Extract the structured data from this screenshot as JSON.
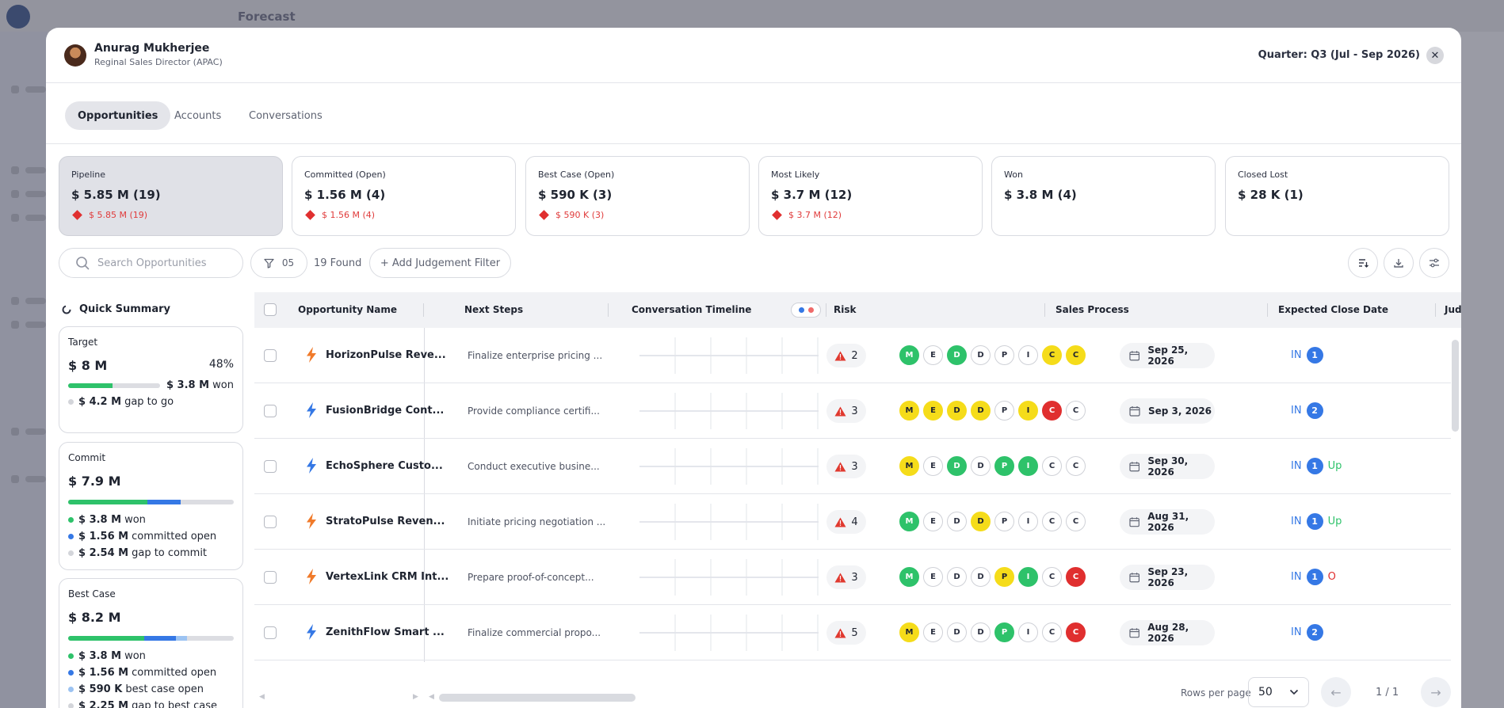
{
  "header": {
    "user_name": "Anurag Mukherjee",
    "user_role": "Reginal Sales Director (APAC)",
    "quarter": "Quarter: Q3 (Jul - Sep 2026)",
    "close_icon": "close-icon"
  },
  "tabs": [
    {
      "label": "Opportunities",
      "active": true
    },
    {
      "label": "Accounts",
      "active": false
    },
    {
      "label": "Conversations",
      "active": false
    }
  ],
  "cards": [
    {
      "label": "Pipeline",
      "value": "$ 5.85 M (19)",
      "sub": "$ 5.85 M (19)"
    },
    {
      "label": "Committed (Open)",
      "value": "$ 1.56 M (4)",
      "sub": "$ 1.56 M (4)"
    },
    {
      "label": "Best Case (Open)",
      "value": "$ 590 K (3)",
      "sub": "$ 590 K (3)"
    },
    {
      "label": "Most Likely",
      "value": "$ 3.7 M (12)",
      "sub": "$ 3.7 M (12)"
    },
    {
      "label": "Won",
      "value": "$ 3.8 M (4)",
      "sub": ""
    },
    {
      "label": "Closed Lost",
      "value": "$ 28 K (1)",
      "sub": ""
    }
  ],
  "filters": {
    "search_placeholder": "Search Opportunities",
    "filter_count": "05",
    "found": "19 Found",
    "add_judgement": "+ Add Judgement Filter"
  },
  "summary": {
    "title": "Quick Summary",
    "target": {
      "label": "Target",
      "value": "$ 8 M",
      "pct": "48%",
      "won_amount": "$ 3.8 M",
      "won_text": "won",
      "gap_amount": "$ 4.2 M",
      "gap_text": "gap to go",
      "fill": 0.48
    },
    "commit": {
      "label": "Commit",
      "value": "$ 7.9 M",
      "won_amount": "$ 3.8 M",
      "won_text": "won",
      "committed_amount": "$ 1.56 M",
      "committed_text": "committed open",
      "gap_amount": "$ 2.54 M",
      "gap_text": "gap to commit",
      "won_fill": 0.48,
      "committed_fill": 0.2
    },
    "best_case": {
      "label": "Best Case",
      "value": "$ 8.2 M",
      "won_amount": "$ 3.8 M",
      "won_text": "won",
      "committed_amount": "$ 1.56 M",
      "committed_text": "committed open",
      "best_amount": "$ 590 K",
      "best_text": "best case open",
      "gap_amount": "$ 2.25 M",
      "gap_text": "gap to best case",
      "won_fill": 0.46,
      "committed_fill": 0.19,
      "best_fill": 0.07
    }
  },
  "table": {
    "headers": {
      "name": "Opportunity Name",
      "next_steps": "Next Steps",
      "timeline": "Conversation Timeline",
      "risk": "Risk",
      "sales_process": "Sales Process",
      "close_date": "Expected Close Date",
      "judgement": "Judgement"
    },
    "rows": [
      {
        "name": "HorizonPulse Reve...",
        "bolt_color": "#f07a2a",
        "next": "Finalize enterprise pricing ...",
        "risk": "2",
        "stages": [
          [
            "M",
            "green"
          ],
          [
            "E",
            ""
          ],
          [
            "D",
            "green"
          ],
          [
            "D",
            ""
          ],
          [
            "P",
            ""
          ],
          [
            "I",
            ""
          ],
          [
            "C",
            "yellow"
          ],
          [
            "C",
            "yellow"
          ]
        ],
        "date": "Sep 25, 2026",
        "judgement": "IN",
        "jnum": "1",
        "jextra": "",
        "jcolor": ""
      },
      {
        "name": "FusionBridge Cont...",
        "bolt_color": "#3578e5",
        "next": "Provide compliance certifi...",
        "risk": "3",
        "stages": [
          [
            "M",
            "yellow"
          ],
          [
            "E",
            "yellow"
          ],
          [
            "D",
            "yellow"
          ],
          [
            "D",
            "yellow"
          ],
          [
            "P",
            ""
          ],
          [
            "I",
            "yellow"
          ],
          [
            "C",
            "red"
          ],
          [
            "C",
            ""
          ]
        ],
        "date": "Sep 3, 2026",
        "judgement": "IN",
        "jnum": "2",
        "jextra": "",
        "jcolor": ""
      },
      {
        "name": "EchoSphere Custo...",
        "bolt_color": "#3578e5",
        "next": "Conduct executive busine...",
        "risk": "3",
        "stages": [
          [
            "M",
            "yellow"
          ],
          [
            "E",
            ""
          ],
          [
            "D",
            "green"
          ],
          [
            "D",
            ""
          ],
          [
            "P",
            "green"
          ],
          [
            "I",
            "green"
          ],
          [
            "C",
            ""
          ],
          [
            "C",
            ""
          ]
        ],
        "date": "Sep 30, 2026",
        "judgement": "IN",
        "jnum": "1",
        "jextra": "Up",
        "jcolor": "#2ec26a"
      },
      {
        "name": "StratoPulse Reven...",
        "bolt_color": "#f07a2a",
        "next": "Initiate pricing negotiation ...",
        "risk": "4",
        "stages": [
          [
            "M",
            "green"
          ],
          [
            "E",
            ""
          ],
          [
            "D",
            ""
          ],
          [
            "D",
            "yellow"
          ],
          [
            "P",
            ""
          ],
          [
            "I",
            ""
          ],
          [
            "C",
            ""
          ],
          [
            "C",
            ""
          ]
        ],
        "date": "Aug 31, 2026",
        "judgement": "IN",
        "jnum": "1",
        "jextra": "Up",
        "jcolor": "#2ec26a"
      },
      {
        "name": "VertexLink CRM Int...",
        "bolt_color": "#f07a2a",
        "next": "Prepare proof-of-concept...",
        "risk": "3",
        "stages": [
          [
            "M",
            "green"
          ],
          [
            "E",
            ""
          ],
          [
            "D",
            ""
          ],
          [
            "D",
            ""
          ],
          [
            "P",
            "yellow"
          ],
          [
            "I",
            "green"
          ],
          [
            "C",
            ""
          ],
          [
            "C",
            "red"
          ]
        ],
        "date": "Sep 23, 2026",
        "judgement": "IN",
        "jnum": "1",
        "jextra": "O",
        "jcolor": "#e02f2f"
      },
      {
        "name": "ZenithFlow Smart ...",
        "bolt_color": "#3578e5",
        "next": "Finalize commercial propo...",
        "risk": "5",
        "stages": [
          [
            "M",
            "yellow"
          ],
          [
            "E",
            ""
          ],
          [
            "D",
            ""
          ],
          [
            "D",
            ""
          ],
          [
            "P",
            "green"
          ],
          [
            "I",
            ""
          ],
          [
            "C",
            ""
          ],
          [
            "C",
            "red"
          ]
        ],
        "date": "Aug 28, 2026",
        "judgement": "IN",
        "jnum": "2",
        "jextra": "",
        "jcolor": ""
      }
    ]
  },
  "footer": {
    "rows_per_page_label": "Rows per page",
    "rows_per_page": "50",
    "page": "1 / 1"
  },
  "background": {
    "page_title": "Forecast"
  }
}
